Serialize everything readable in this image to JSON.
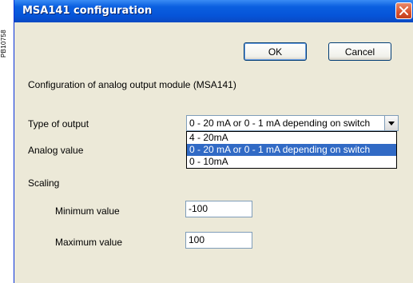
{
  "figure_code": "PB10758",
  "window": {
    "title": "MSA141 configuration"
  },
  "buttons": {
    "ok": "OK",
    "cancel": "Cancel"
  },
  "description": "Configuration of analog output module (MSA141)",
  "type_of_output": {
    "label": "Type of output",
    "selected": "0 - 20 mA or 0 - 1 mA depending on switch",
    "options": [
      "4 - 20mA",
      "0 - 20 mA or 0 - 1 mA depending on switch",
      "0 - 10mA"
    ],
    "highlighted_index": 1
  },
  "analog_value": {
    "label": "Analog value"
  },
  "scaling": {
    "label": "Scaling",
    "minimum": {
      "label": "Minimum value",
      "value": "-100"
    },
    "maximum": {
      "label": "Maximum value",
      "value": "100"
    }
  },
  "colors": {
    "highlight": "#316ac5",
    "titlebar": "#0a5fe0",
    "dialog_bg": "#ece9d8"
  }
}
